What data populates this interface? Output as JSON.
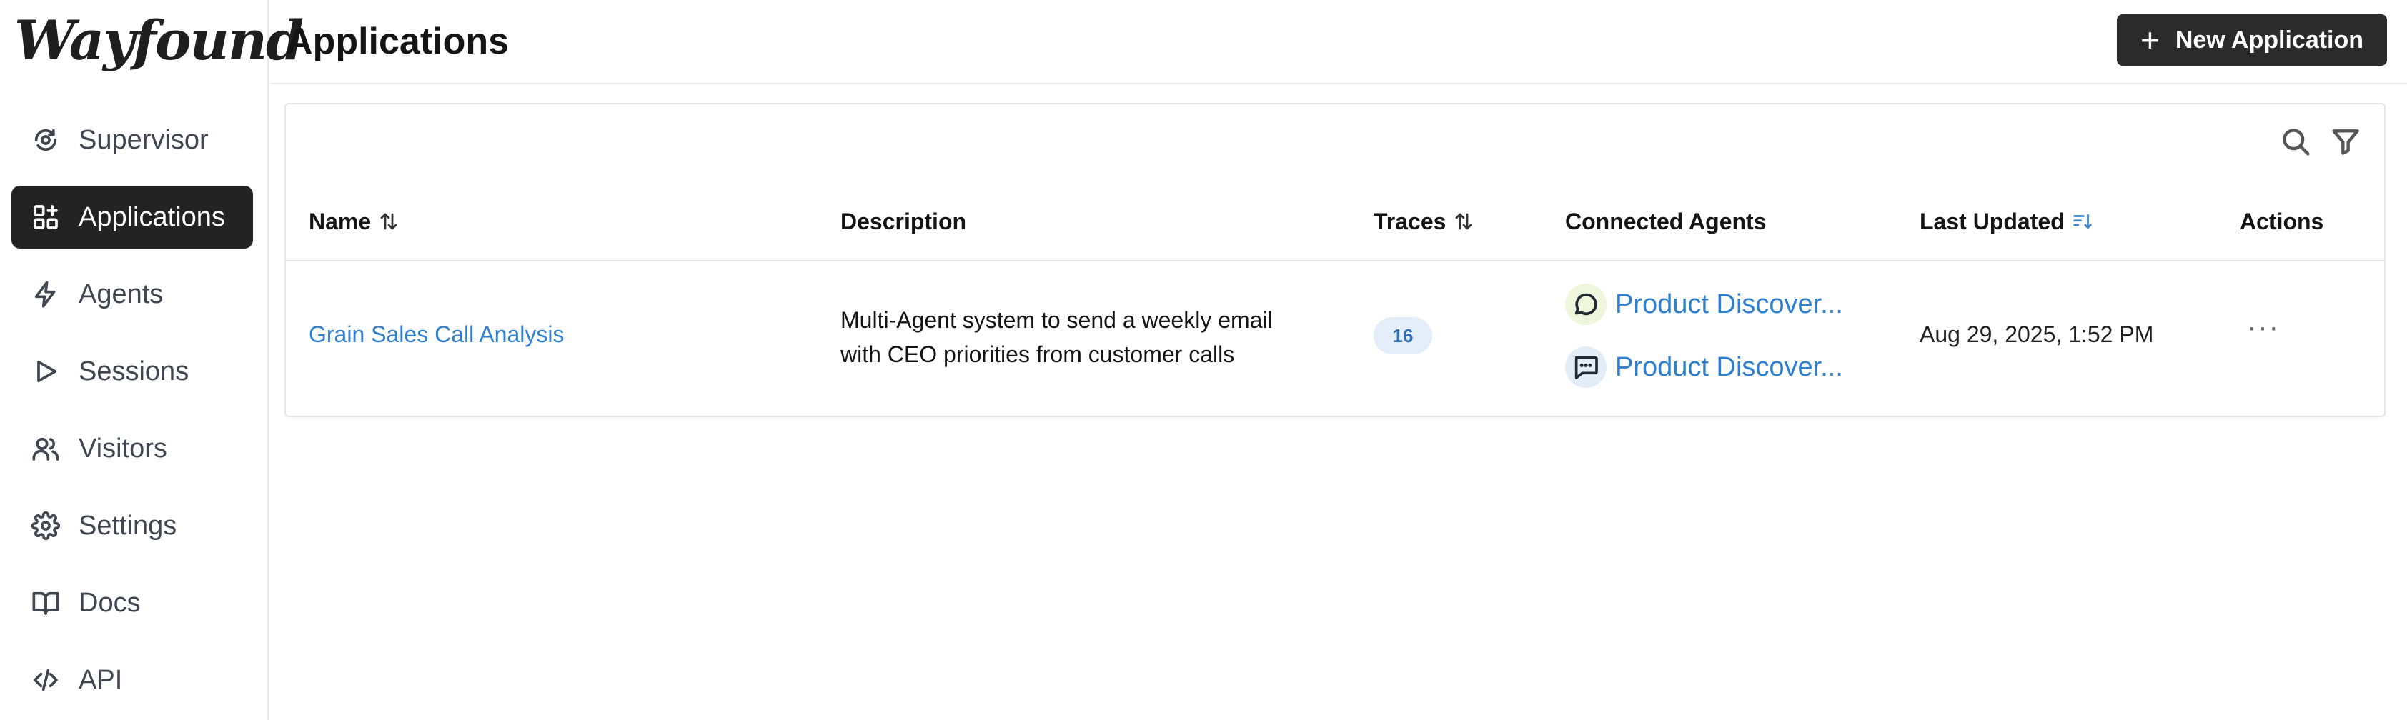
{
  "brand": {
    "logo_text": "Wayfound"
  },
  "sidebar": {
    "items": [
      {
        "label": "Supervisor",
        "icon": "supervisor-icon"
      },
      {
        "label": "Applications",
        "icon": "grid-plus-icon",
        "active": true
      },
      {
        "label": "Agents",
        "icon": "bolt-icon"
      },
      {
        "label": "Sessions",
        "icon": "play-icon"
      },
      {
        "label": "Visitors",
        "icon": "users-icon"
      },
      {
        "label": "Settings",
        "icon": "gear-icon"
      },
      {
        "label": "Docs",
        "icon": "book-icon"
      },
      {
        "label": "API",
        "icon": "code-icon"
      }
    ]
  },
  "header": {
    "title": "Applications",
    "new_button_label": "New Application"
  },
  "table": {
    "columns": {
      "name": "Name",
      "description": "Description",
      "traces": "Traces",
      "connected_agents": "Connected Agents",
      "last_updated": "Last Updated",
      "actions": "Actions"
    },
    "rows": [
      {
        "name": "Grain Sales Call Analysis",
        "description_line1": "Multi-Agent system to send a weekly email",
        "description_line2": "with CEO priorities from customer calls",
        "traces": "16",
        "agents": [
          {
            "label": "Product Discover...",
            "icon": "chat-bubble-icon"
          },
          {
            "label": "Product Discover...",
            "icon": "message-dots-icon"
          }
        ],
        "last_updated": "Aug 29, 2025, 1:52 PM",
        "actions_label": "···"
      }
    ]
  },
  "colors": {
    "accent_link": "#2f7fcf",
    "active_nav_bg": "#232323",
    "badge_bg": "#e3eefa",
    "agent1_icon_bg": "#eef6dc",
    "agent2_icon_bg": "#e2edf8"
  }
}
